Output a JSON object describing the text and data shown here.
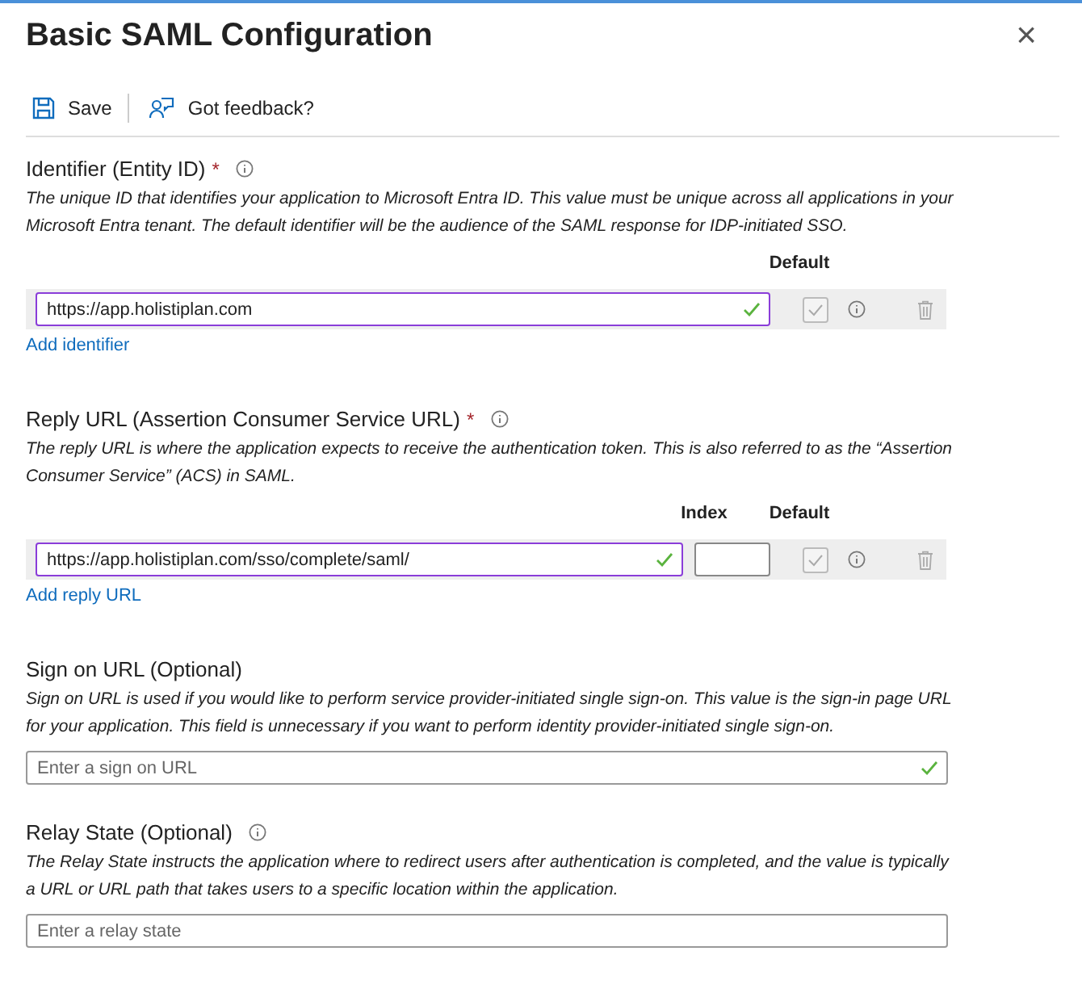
{
  "panel": {
    "title": "Basic SAML Configuration",
    "close_icon": "×"
  },
  "toolbar": [
    {
      "kind": "save",
      "label": "Save"
    },
    {
      "kind": "feedback",
      "label": "Got feedback?"
    }
  ],
  "sections": [
    {
      "kind": "table",
      "title": "Identifier (Entity ID)",
      "required_mark": "*",
      "info": true,
      "description": "The unique ID that identifies your application to Microsoft Entra ID. This value must be unique across all applications in your Microsoft Entra tenant. The default identifier will be the audience of the SAML response for IDP-initiated SSO.",
      "columns": [
        {
          "kind": "default",
          "label": "Default"
        }
      ],
      "rows": [
        {
          "value": "https://app.holistiplan.com",
          "valid": true,
          "focused": true,
          "default_checked": true
        }
      ],
      "add_link": "Add identifier"
    },
    {
      "kind": "table",
      "title": "Reply URL (Assertion Consumer Service URL)",
      "required_mark": "*",
      "info": true,
      "description": "The reply URL is where the application expects to receive the authentication token. This is also referred to as the “Assertion Consumer Service” (ACS) in SAML.",
      "columns": [
        {
          "kind": "index",
          "label": "Index"
        },
        {
          "kind": "default",
          "label": "Default"
        }
      ],
      "rows": [
        {
          "value": "https://app.holistiplan.com/sso/complete/saml/",
          "valid": true,
          "focused": true,
          "default_checked": true
        }
      ],
      "add_link": "Add reply URL"
    },
    {
      "kind": "single",
      "title": "Sign on URL (Optional)",
      "info": false,
      "description": "Sign on URL is used if you would like to perform service provider-initiated single sign-on. This value is the sign-in page URL for your application. This field is unnecessary if you want to perform identity provider-initiated single sign-on.",
      "field": {
        "placeholder": "Enter a sign on URL",
        "valid": true
      }
    },
    {
      "kind": "single",
      "title": "Relay State (Optional)",
      "info": true,
      "description": "The Relay State instructs the application where to redirect users after authentication is completed, and the value is typically a URL or URL path that takes users to a specific location within the application.",
      "field": {
        "placeholder": "Enter a relay state",
        "valid": false
      }
    }
  ]
}
